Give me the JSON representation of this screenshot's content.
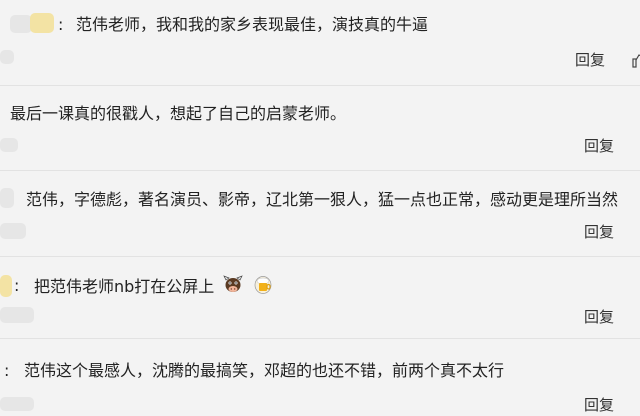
{
  "comments": [
    {
      "text": "范伟老师，我和我的家乡表现最佳，演技真的牛逼",
      "colon": ":",
      "reply_label": "回复"
    },
    {
      "text": "最后一课真的很戳人，想起了自己的启蒙老师。",
      "reply_label": "回复"
    },
    {
      "text": "范伟，字德彪，著名演员、影帝，辽北第一狠人，猛一点也正常，感动更是理所当然",
      "reply_label": "回复"
    },
    {
      "text": "把范伟老师nb打在公屏上",
      "colon": ":",
      "emojis": [
        "cow-emoji",
        "beer-emoji"
      ],
      "reply_label": "回复"
    },
    {
      "text": "范伟这个最感人，沈腾的最搞笑，邓超的也还不错，前两个真不太行",
      "colon": ":",
      "reply_label": "回复"
    }
  ]
}
